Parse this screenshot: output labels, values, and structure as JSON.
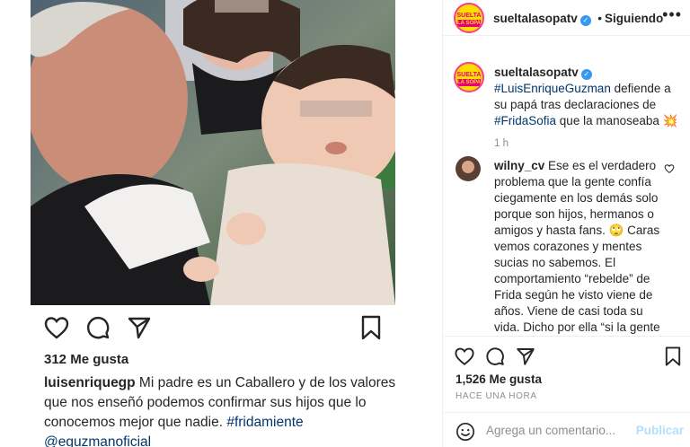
{
  "left_post": {
    "likes": "312 Me gusta",
    "caption": {
      "username": "luisenriquegp",
      "text": " Mi padre es un Caballero y de  los valores que nos enseñó  podemos confirmar sus hijos que lo conocemos mejor que nadie. ",
      "hashtag": "#fridamiente",
      "mention": "@eguzmanoficial"
    },
    "icons": [
      "heart-icon",
      "comment-icon",
      "share-icon",
      "save-icon"
    ]
  },
  "right_panel": {
    "header": {
      "username": "sueltalasopatv",
      "follow_state": "Siguiendo",
      "avatar_brand_top": "SUELTA",
      "avatar_brand_bottom": "LA SOPA"
    },
    "main_post": {
      "username": "sueltalasopatv",
      "mention": "#LuisEnriqueGuzman",
      "text1": " defiende a su papá tras declaraciones de ",
      "hashtag": "#FridaSofia",
      "text2": " que la manoseaba 💥",
      "time": "1 h"
    },
    "comment": {
      "username": "wilny_cv",
      "text": "Ese es el verdadero problema que la gente confía ciegamente en los demás solo porque son hijos, hermanos o amigos y hasta fans. 🙄 Caras vemos corazones y mentes sucias no sabemos. El comportamiento “rebelde” de Frida según he visto viene de años. Viene de casi toda su vida. Dicho por ella “si la gente supiera por todo lo que he pasado no me juzgarían” nadie"
    },
    "likes": "1,526 Me gusta",
    "timestamp": "HACE UNA HORA",
    "add_comment_placeholder": "Agrega un comentario...",
    "publish_label": "Publicar"
  },
  "colors": {
    "link": "#00376b",
    "muted": "#8e8e8e",
    "verified": "#3897f0",
    "publish_disabled": "#b2dffc",
    "brand_yellow": "#ffdd00",
    "brand_pink": "#e6007e"
  }
}
